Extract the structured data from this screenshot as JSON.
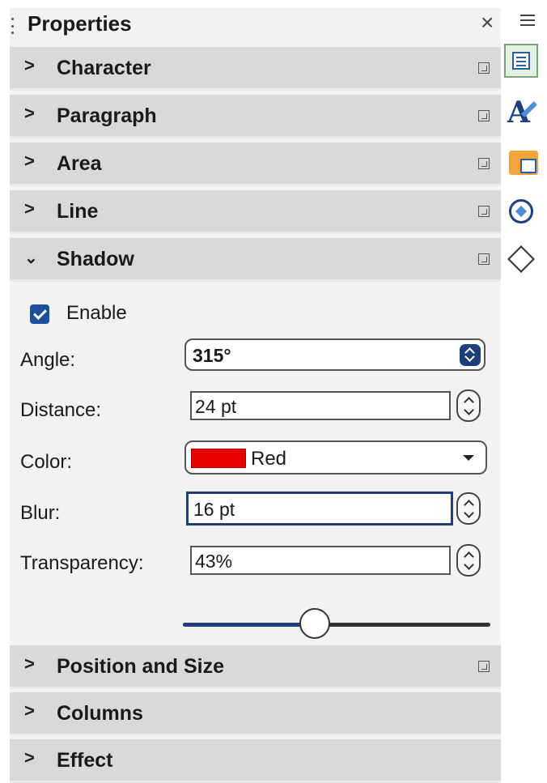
{
  "panel": {
    "title": "Properties",
    "close_glyph": "×"
  },
  "sections_collapsed_top": [
    {
      "label": "Character",
      "chevron": ">"
    },
    {
      "label": "Paragraph",
      "chevron": ">"
    },
    {
      "label": "Area",
      "chevron": ">"
    },
    {
      "label": "Line",
      "chevron": ">"
    }
  ],
  "shadow": {
    "label": "Shadow",
    "chevron": "⌄",
    "enable_label": "Enable",
    "enabled": true,
    "angle_label": "Angle:",
    "angle_value": "315°",
    "distance_label": "Distance:",
    "distance_value": "24 pt",
    "color_label": "Color:",
    "color_value": "Red",
    "color_hex": "#e80000",
    "blur_label": "Blur:",
    "blur_value": "16 pt",
    "transparency_label": "Transparency:",
    "transparency_value": "43%",
    "transparency_fraction": 0.43
  },
  "sections_collapsed_bottom": [
    {
      "label": "Position and Size",
      "chevron": ">",
      "has_more": true
    },
    {
      "label": "Columns",
      "chevron": ">",
      "has_more": false
    },
    {
      "label": "Effect",
      "chevron": ">",
      "has_more": false
    }
  ],
  "deck": {
    "menu_icon": "hamburger-menu-icon",
    "buttons": [
      "properties-icon",
      "styles-icon",
      "gallery-icon",
      "navigator-icon",
      "shapes-icon"
    ],
    "active": "properties-icon"
  },
  "colors": {
    "accent": "#1f3f7a",
    "section_bg": "#d9d9d9",
    "panel_bg": "#f2f2f2"
  }
}
